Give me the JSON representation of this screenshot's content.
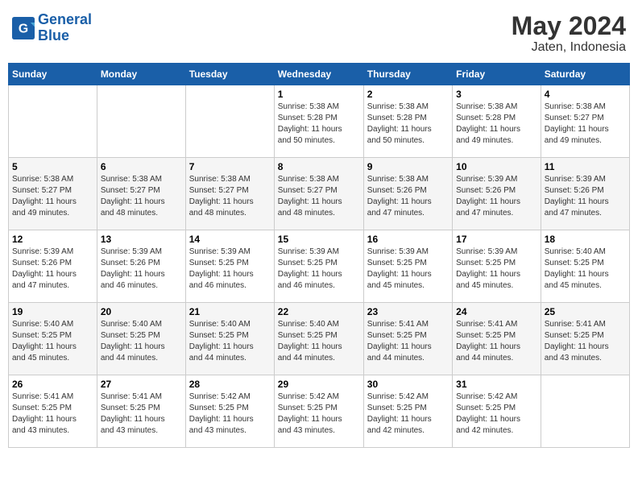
{
  "logo": {
    "text_general": "General",
    "text_blue": "Blue"
  },
  "title": {
    "month_year": "May 2024",
    "location": "Jaten, Indonesia"
  },
  "headers": [
    "Sunday",
    "Monday",
    "Tuesday",
    "Wednesday",
    "Thursday",
    "Friday",
    "Saturday"
  ],
  "weeks": [
    [
      {
        "day": "",
        "info": ""
      },
      {
        "day": "",
        "info": ""
      },
      {
        "day": "",
        "info": ""
      },
      {
        "day": "1",
        "info": "Sunrise: 5:38 AM\nSunset: 5:28 PM\nDaylight: 11 hours\nand 50 minutes."
      },
      {
        "day": "2",
        "info": "Sunrise: 5:38 AM\nSunset: 5:28 PM\nDaylight: 11 hours\nand 50 minutes."
      },
      {
        "day": "3",
        "info": "Sunrise: 5:38 AM\nSunset: 5:28 PM\nDaylight: 11 hours\nand 49 minutes."
      },
      {
        "day": "4",
        "info": "Sunrise: 5:38 AM\nSunset: 5:27 PM\nDaylight: 11 hours\nand 49 minutes."
      }
    ],
    [
      {
        "day": "5",
        "info": "Sunrise: 5:38 AM\nSunset: 5:27 PM\nDaylight: 11 hours\nand 49 minutes."
      },
      {
        "day": "6",
        "info": "Sunrise: 5:38 AM\nSunset: 5:27 PM\nDaylight: 11 hours\nand 48 minutes."
      },
      {
        "day": "7",
        "info": "Sunrise: 5:38 AM\nSunset: 5:27 PM\nDaylight: 11 hours\nand 48 minutes."
      },
      {
        "day": "8",
        "info": "Sunrise: 5:38 AM\nSunset: 5:27 PM\nDaylight: 11 hours\nand 48 minutes."
      },
      {
        "day": "9",
        "info": "Sunrise: 5:38 AM\nSunset: 5:26 PM\nDaylight: 11 hours\nand 47 minutes."
      },
      {
        "day": "10",
        "info": "Sunrise: 5:39 AM\nSunset: 5:26 PM\nDaylight: 11 hours\nand 47 minutes."
      },
      {
        "day": "11",
        "info": "Sunrise: 5:39 AM\nSunset: 5:26 PM\nDaylight: 11 hours\nand 47 minutes."
      }
    ],
    [
      {
        "day": "12",
        "info": "Sunrise: 5:39 AM\nSunset: 5:26 PM\nDaylight: 11 hours\nand 47 minutes."
      },
      {
        "day": "13",
        "info": "Sunrise: 5:39 AM\nSunset: 5:26 PM\nDaylight: 11 hours\nand 46 minutes."
      },
      {
        "day": "14",
        "info": "Sunrise: 5:39 AM\nSunset: 5:25 PM\nDaylight: 11 hours\nand 46 minutes."
      },
      {
        "day": "15",
        "info": "Sunrise: 5:39 AM\nSunset: 5:25 PM\nDaylight: 11 hours\nand 46 minutes."
      },
      {
        "day": "16",
        "info": "Sunrise: 5:39 AM\nSunset: 5:25 PM\nDaylight: 11 hours\nand 45 minutes."
      },
      {
        "day": "17",
        "info": "Sunrise: 5:39 AM\nSunset: 5:25 PM\nDaylight: 11 hours\nand 45 minutes."
      },
      {
        "day": "18",
        "info": "Sunrise: 5:40 AM\nSunset: 5:25 PM\nDaylight: 11 hours\nand 45 minutes."
      }
    ],
    [
      {
        "day": "19",
        "info": "Sunrise: 5:40 AM\nSunset: 5:25 PM\nDaylight: 11 hours\nand 45 minutes."
      },
      {
        "day": "20",
        "info": "Sunrise: 5:40 AM\nSunset: 5:25 PM\nDaylight: 11 hours\nand 44 minutes."
      },
      {
        "day": "21",
        "info": "Sunrise: 5:40 AM\nSunset: 5:25 PM\nDaylight: 11 hours\nand 44 minutes."
      },
      {
        "day": "22",
        "info": "Sunrise: 5:40 AM\nSunset: 5:25 PM\nDaylight: 11 hours\nand 44 minutes."
      },
      {
        "day": "23",
        "info": "Sunrise: 5:41 AM\nSunset: 5:25 PM\nDaylight: 11 hours\nand 44 minutes."
      },
      {
        "day": "24",
        "info": "Sunrise: 5:41 AM\nSunset: 5:25 PM\nDaylight: 11 hours\nand 44 minutes."
      },
      {
        "day": "25",
        "info": "Sunrise: 5:41 AM\nSunset: 5:25 PM\nDaylight: 11 hours\nand 43 minutes."
      }
    ],
    [
      {
        "day": "26",
        "info": "Sunrise: 5:41 AM\nSunset: 5:25 PM\nDaylight: 11 hours\nand 43 minutes."
      },
      {
        "day": "27",
        "info": "Sunrise: 5:41 AM\nSunset: 5:25 PM\nDaylight: 11 hours\nand 43 minutes."
      },
      {
        "day": "28",
        "info": "Sunrise: 5:42 AM\nSunset: 5:25 PM\nDaylight: 11 hours\nand 43 minutes."
      },
      {
        "day": "29",
        "info": "Sunrise: 5:42 AM\nSunset: 5:25 PM\nDaylight: 11 hours\nand 43 minutes."
      },
      {
        "day": "30",
        "info": "Sunrise: 5:42 AM\nSunset: 5:25 PM\nDaylight: 11 hours\nand 42 minutes."
      },
      {
        "day": "31",
        "info": "Sunrise: 5:42 AM\nSunset: 5:25 PM\nDaylight: 11 hours\nand 42 minutes."
      },
      {
        "day": "",
        "info": ""
      }
    ]
  ]
}
